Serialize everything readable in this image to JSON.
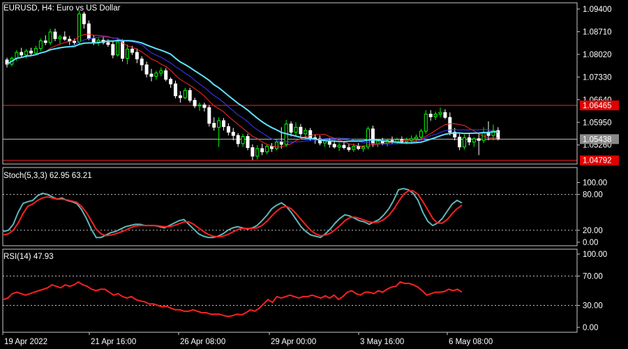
{
  "colors": {
    "background": "#000000",
    "frame": "#c8c8c8",
    "text": "#ffffff",
    "bull_candle": "#00ff00",
    "bear_candle": "#ffffff",
    "ma_fast": "#ff2a2a",
    "ma_mid": "#3a3aff",
    "ma_slow": "#5fe3ff",
    "level_line": "#ff2020",
    "bid_line": "#c0c0c0",
    "level_tag_bg": "#e00000",
    "bid_tag_bg": "#8a8a8a",
    "stoch_main": "#5fb8b8",
    "stoch_signal": "#ff2020",
    "rsi": "#ff2020",
    "dotted": "#bfbfbf"
  },
  "main": {
    "title": "EURUSD, H4:  Euro vs US Dollar",
    "price_ticks": [
      "1.09400",
      "1.08710",
      "1.08020",
      "1.07330",
      "1.06640",
      "1.05950",
      "1.05260"
    ],
    "level_high": {
      "value": 1.06465,
      "label": "1.06465"
    },
    "bid": {
      "value": 1.05438,
      "label": "1.05438"
    },
    "level_low": {
      "value": 1.04792,
      "label": "1.04792"
    }
  },
  "stoch": {
    "title": "Stoch(5,3,3) 62.95 63.21",
    "ticks": [
      "100.00",
      "80.00",
      "20.00",
      "0.00"
    ],
    "levels": [
      80,
      20
    ]
  },
  "rsi": {
    "title": "RSI(14) 47.93",
    "ticks": [
      "100.00",
      "70.00",
      "30.00",
      "0.00"
    ],
    "levels": [
      70,
      30
    ]
  },
  "time_axis": {
    "labels": [
      "19 Apr 2022",
      "21 Apr 16:00",
      "26 Apr 08:00",
      "29 Apr 00:00",
      "3 May 16:00",
      "6 May 08:00"
    ]
  },
  "chart_data": [
    {
      "type": "candlestick",
      "title": "EURUSD, H4:  Euro vs US Dollar",
      "ylim": [
        1.0468,
        1.0959
      ],
      "series": [
        {
          "name": "EURUSD",
          "candles": [
            [
              1.0785,
              1.0792,
              1.0762,
              1.0772
            ],
            [
              1.0772,
              1.0795,
              1.0765,
              1.079
            ],
            [
              1.079,
              1.0815,
              1.0782,
              1.0808
            ],
            [
              1.0808,
              1.0822,
              1.0792,
              1.08
            ],
            [
              1.08,
              1.0818,
              1.079,
              1.0812
            ],
            [
              1.0812,
              1.0822,
              1.08,
              1.0806
            ],
            [
              1.0806,
              1.0828,
              1.08,
              1.082
            ],
            [
              1.082,
              1.085,
              1.0812,
              1.0843
            ],
            [
              1.0843,
              1.086,
              1.083,
              1.0838
            ],
            [
              1.0838,
              1.088,
              1.083,
              1.087
            ],
            [
              1.087,
              1.088,
              1.0842,
              1.085
            ],
            [
              1.085,
              1.0862,
              1.0835,
              1.0855
            ],
            [
              1.0855,
              1.0872,
              1.0843,
              1.0848
            ],
            [
              1.0848,
              1.0858,
              1.083,
              1.0842
            ],
            [
              1.0842,
              1.085,
              1.083,
              1.0838
            ],
            [
              1.084,
              1.0936,
              1.0835,
              1.0925
            ],
            [
              1.0925,
              1.0932,
              1.088,
              1.0895
            ],
            [
              1.0895,
              1.0905,
              1.0845,
              1.085
            ],
            [
              1.085,
              1.086,
              1.083,
              1.084
            ],
            [
              1.084,
              1.0852,
              1.0828,
              1.0845
            ],
            [
              1.0845,
              1.0855,
              1.0832,
              1.0838
            ],
            [
              1.0838,
              1.0848,
              1.0825,
              1.0832
            ],
            [
              1.0832,
              1.0842,
              1.079,
              1.08
            ],
            [
              1.08,
              1.0852,
              1.0795,
              1.084
            ],
            [
              1.084,
              1.0848,
              1.078,
              1.079
            ],
            [
              1.079,
              1.0832,
              1.0772,
              1.0818
            ],
            [
              1.0818,
              1.0828,
              1.08,
              1.0808
            ],
            [
              1.0808,
              1.082,
              1.0775,
              1.0788
            ],
            [
              1.0788,
              1.0796,
              1.0752,
              1.077
            ],
            [
              1.077,
              1.078,
              1.0732,
              1.0742
            ],
            [
              1.0742,
              1.0758,
              1.072,
              1.0735
            ],
            [
              1.0735,
              1.0752,
              1.0725,
              1.0745
            ],
            [
              1.0745,
              1.0762,
              1.0735,
              1.0752
            ],
            [
              1.0752,
              1.076,
              1.072,
              1.0726
            ],
            [
              1.0726,
              1.0732,
              1.07,
              1.0712
            ],
            [
              1.0712,
              1.0722,
              1.0668,
              1.0676
            ],
            [
              1.0676,
              1.069,
              1.0655,
              1.067
            ],
            [
              1.067,
              1.07,
              1.0665,
              1.0692
            ],
            [
              1.0692,
              1.07,
              1.0655,
              1.0662
            ],
            [
              1.0662,
              1.067,
              1.0638,
              1.0645
            ],
            [
              1.0645,
              1.0655,
              1.063,
              1.0648
            ],
            [
              1.0648,
              1.0655,
              1.0628,
              1.064
            ],
            [
              1.064,
              1.0648,
              1.0582,
              1.0592
            ],
            [
              1.0592,
              1.061,
              1.057,
              1.058
            ],
            [
              1.058,
              1.061,
              1.052,
              1.06
            ],
            [
              1.06,
              1.0608,
              1.057,
              1.0582
            ],
            [
              1.0582,
              1.0592,
              1.0555,
              1.0565
            ],
            [
              1.0565,
              1.0578,
              1.054,
              1.0555
            ],
            [
              1.0555,
              1.0562,
              1.052,
              1.053
            ],
            [
              1.053,
              1.056,
              1.052,
              1.0552
            ],
            [
              1.0552,
              1.056,
              1.051,
              1.0518
            ],
            [
              1.0518,
              1.0528,
              1.048,
              1.0492
            ],
            [
              1.0492,
              1.0525,
              1.0482,
              1.0515
            ],
            [
              1.0515,
              1.053,
              1.0495,
              1.0505
            ],
            [
              1.0505,
              1.0528,
              1.0498,
              1.0522
            ],
            [
              1.0522,
              1.0532,
              1.0505,
              1.0515
            ],
            [
              1.0515,
              1.0545,
              1.051,
              1.0535
            ],
            [
              1.0535,
              1.058,
              1.0515,
              1.0528
            ],
            [
              1.0528,
              1.0602,
              1.052,
              1.059
            ],
            [
              1.059,
              1.0598,
              1.0552,
              1.0565
            ],
            [
              1.0565,
              1.0595,
              1.0555,
              1.058
            ],
            [
              1.058,
              1.059,
              1.055,
              1.056
            ],
            [
              1.056,
              1.0578,
              1.0545,
              1.057
            ],
            [
              1.057,
              1.0578,
              1.054,
              1.0548
            ],
            [
              1.0548,
              1.0558,
              1.053,
              1.0545
            ],
            [
              1.0545,
              1.0555,
              1.0525,
              1.0532
            ],
            [
              1.0532,
              1.0545,
              1.052,
              1.0538
            ],
            [
              1.0538,
              1.0548,
              1.0518,
              1.0528
            ],
            [
              1.0528,
              1.054,
              1.0515,
              1.052
            ],
            [
              1.052,
              1.0532,
              1.0508,
              1.0525
            ],
            [
              1.0525,
              1.0535,
              1.0512,
              1.0518
            ],
            [
              1.0518,
              1.0528,
              1.0505,
              1.0512
            ],
            [
              1.0512,
              1.053,
              1.0505,
              1.0522
            ],
            [
              1.0522,
              1.0532,
              1.051,
              1.0515
            ],
            [
              1.0515,
              1.0525,
              1.0505,
              1.052
            ],
            [
              1.052,
              1.0582,
              1.0512,
              1.0575
            ],
            [
              1.0575,
              1.0585,
              1.052,
              1.053
            ],
            [
              1.053,
              1.0545,
              1.052,
              1.0538
            ],
            [
              1.0538,
              1.0548,
              1.0525,
              1.0532
            ],
            [
              1.0532,
              1.0545,
              1.0522,
              1.054
            ],
            [
              1.054,
              1.0552,
              1.053,
              1.0535
            ],
            [
              1.0535,
              1.0548,
              1.0528,
              1.0542
            ],
            [
              1.0542,
              1.0552,
              1.053,
              1.0536
            ],
            [
              1.0536,
              1.0548,
              1.0528,
              1.054
            ],
            [
              1.054,
              1.0555,
              1.053,
              1.0545
            ],
            [
              1.0545,
              1.0558,
              1.0535,
              1.055
            ],
            [
              1.055,
              1.0575,
              1.054,
              1.0568
            ],
            [
              1.0568,
              1.0632,
              1.056,
              1.062
            ],
            [
              1.062,
              1.0632,
              1.06,
              1.0612
            ],
            [
              1.0612,
              1.0628,
              1.0602,
              1.062
            ],
            [
              1.062,
              1.064,
              1.061,
              1.0625
            ],
            [
              1.0625,
              1.0635,
              1.0605,
              1.061
            ],
            [
              1.061,
              1.0625,
              1.0555,
              1.0565
            ],
            [
              1.0565,
              1.0578,
              1.054,
              1.055
            ],
            [
              1.055,
              1.056,
              1.051,
              1.052
            ],
            [
              1.052,
              1.0558,
              1.0512,
              1.0548
            ],
            [
              1.0548,
              1.0562,
              1.0525,
              1.0535
            ],
            [
              1.0535,
              1.055,
              1.052,
              1.0545
            ],
            [
              1.0545,
              1.056,
              1.0495,
              1.054
            ],
            [
              1.054,
              1.058,
              1.0532,
              1.0565
            ],
            [
              1.0565,
              1.0598,
              1.054,
              1.0555
            ],
            [
              1.0555,
              1.0588,
              1.054,
              1.057
            ],
            [
              1.057,
              1.058,
              1.054,
              1.0545
            ]
          ]
        }
      ],
      "ma": [
        {
          "name": "MA fast",
          "color": "#ff2a2a",
          "period": 9
        },
        {
          "name": "MA mid",
          "color": "#3a3aff",
          "period": 14
        },
        {
          "name": "MA slow",
          "color": "#5fe3ff",
          "period": 20
        }
      ],
      "horizontal_levels": [
        1.06465,
        1.05438,
        1.04792
      ]
    },
    {
      "type": "line",
      "title": "Stoch(5,3,3) 62.95 63.21",
      "ylim": [
        0,
        100
      ],
      "levels": [
        80,
        20
      ],
      "series": [
        {
          "name": "main",
          "values": [
            18,
            20,
            30,
            50,
            65,
            68,
            70,
            78,
            82,
            80,
            76,
            72,
            74,
            70,
            68,
            65,
            55,
            40,
            22,
            8,
            8,
            12,
            16,
            18,
            22,
            26,
            28,
            30,
            30,
            28,
            28,
            28,
            26,
            24,
            28,
            32,
            36,
            38,
            30,
            22,
            14,
            10,
            8,
            8,
            10,
            14,
            20,
            24,
            26,
            24,
            22,
            24,
            28,
            36,
            45,
            56,
            62,
            66,
            60,
            50,
            38,
            26,
            18,
            12,
            10,
            8,
            14,
            22,
            32,
            40,
            46,
            44,
            40,
            36,
            34,
            30,
            34,
            38,
            46,
            56,
            70,
            88,
            90,
            88,
            82,
            70,
            50,
            35,
            28,
            32,
            40,
            52,
            64,
            70,
            66
          ]
        },
        {
          "name": "signal",
          "values": [
            12,
            14,
            20,
            32,
            48,
            60,
            64,
            70,
            74,
            76,
            74,
            72,
            72,
            71,
            69,
            67,
            60,
            50,
            36,
            22,
            14,
            11,
            12,
            14,
            17,
            20,
            24,
            27,
            28,
            28,
            28,
            28,
            27,
            26,
            26,
            28,
            31,
            34,
            34,
            30,
            24,
            18,
            13,
            10,
            9,
            10,
            13,
            17,
            21,
            23,
            23,
            23,
            24,
            28,
            35,
            44,
            52,
            58,
            60,
            56,
            48,
            38,
            29,
            20,
            14,
            11,
            12,
            15,
            21,
            28,
            36,
            41,
            42,
            40,
            37,
            34,
            33,
            34,
            38,
            45,
            55,
            68,
            80,
            86,
            86,
            80,
            68,
            54,
            40,
            32,
            32,
            38,
            48,
            56,
            62
          ]
        }
      ]
    },
    {
      "type": "line",
      "title": "RSI(14) 47.93",
      "ylim": [
        0,
        100
      ],
      "levels": [
        70,
        30
      ],
      "series": [
        {
          "name": "RSI(14)",
          "values": [
            38,
            40,
            46,
            48,
            46,
            44,
            46,
            48,
            50,
            52,
            54,
            58,
            56,
            54,
            58,
            56,
            58,
            62,
            58,
            56,
            52,
            50,
            52,
            52,
            48,
            44,
            46,
            42,
            40,
            42,
            38,
            36,
            35,
            32,
            32,
            30,
            28,
            29,
            26,
            24,
            24,
            22,
            22,
            24,
            22,
            20,
            20,
            18,
            18,
            18,
            16,
            15,
            16,
            18,
            17,
            20,
            24,
            22,
            26,
            32,
            38,
            34,
            42,
            40,
            42,
            44,
            42,
            40,
            42,
            42,
            44,
            42,
            40,
            43,
            40,
            44,
            38,
            42,
            48,
            50,
            46,
            44,
            48,
            48,
            46,
            50,
            48,
            52,
            55,
            56,
            62,
            60,
            60,
            58,
            55,
            50,
            44,
            46,
            48,
            48,
            49,
            52,
            50,
            52,
            48
          ]
        }
      ]
    }
  ]
}
